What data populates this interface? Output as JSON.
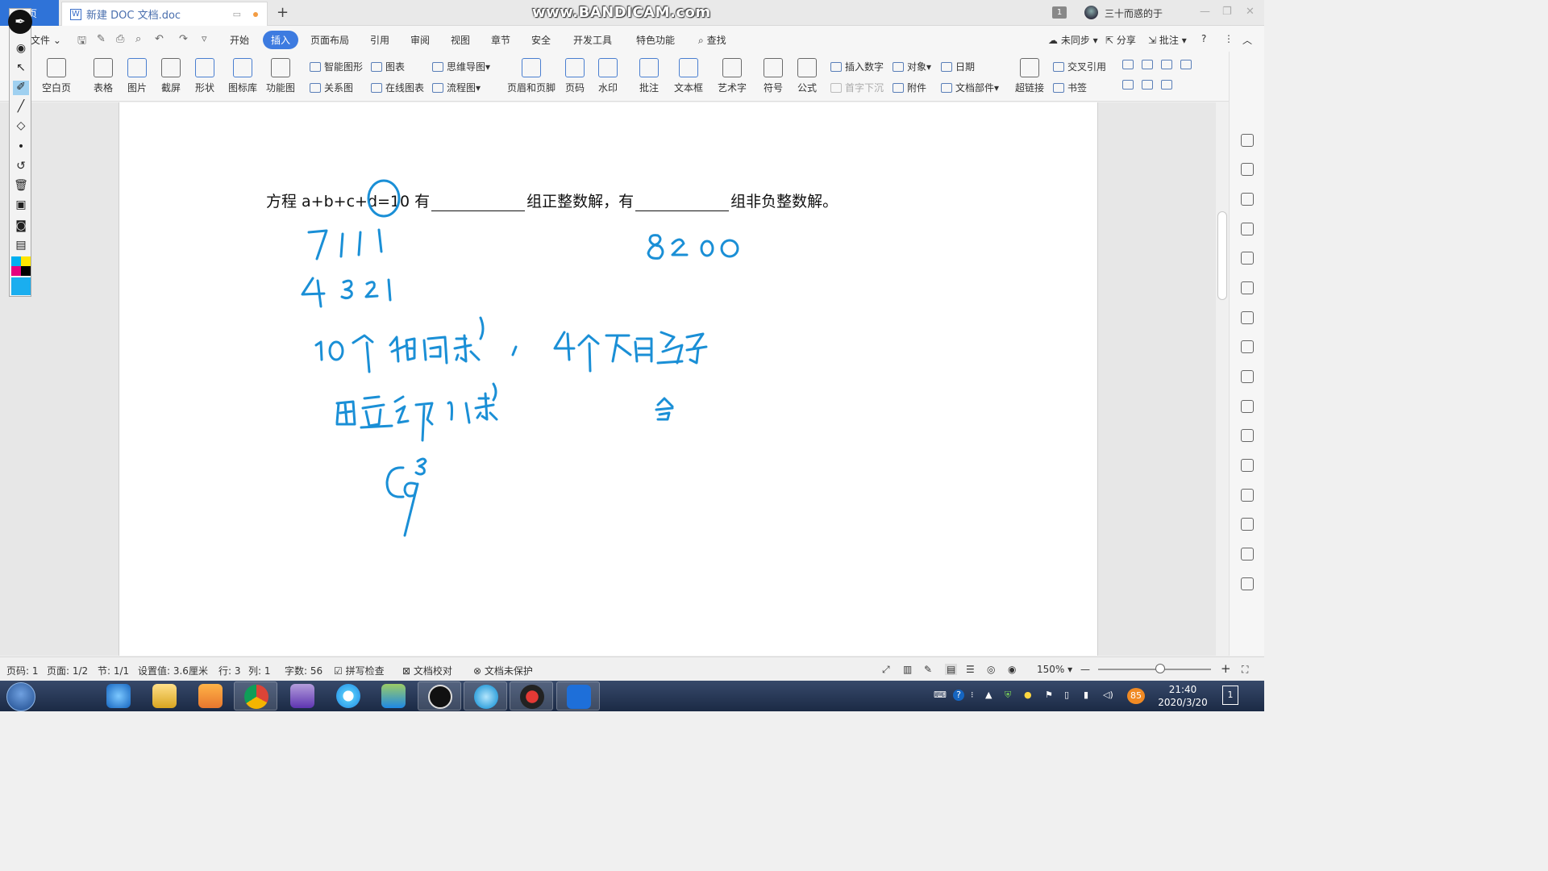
{
  "window": {
    "home_tab": "首页",
    "doc_tab": "新建 DOC 文档.doc",
    "new_tab": "+",
    "watermark": "www.BANDICAM.com",
    "badge": "1",
    "user": "三十而惑的于"
  },
  "menu": {
    "file": "文件",
    "tabs": [
      "开始",
      "插入",
      "页面布局",
      "引用",
      "审阅",
      "视图",
      "章节",
      "安全",
      "开发工具",
      "特色功能"
    ],
    "active_tab": "插入",
    "search": "查找",
    "right": [
      "未同步",
      "分享",
      "批注"
    ]
  },
  "ribbon": {
    "large": [
      "空白页",
      "表格",
      "图片",
      "截屏",
      "形状",
      "图标库",
      "功能图",
      "页眉和页脚",
      "页码",
      "水印",
      "批注",
      "文本框",
      "艺术字",
      "符号",
      "公式",
      "超链接"
    ],
    "small": [
      "智能图形",
      "图表",
      "思维导图",
      "关系图",
      "在线图表",
      "流程图",
      "插入数字",
      "对象",
      "日期",
      "首字下沉",
      "附件",
      "文档部件",
      "交叉引用",
      "书签"
    ]
  },
  "document": {
    "question_part1": "方程 a+b+c+d=10 有",
    "question_part2": "组正整数解，有",
    "question_part3": "组非负整数解。"
  },
  "statusbar": {
    "page": "页码: 1",
    "pages": "页面: 1/2",
    "section": "节: 1/1",
    "setting": "设置值: 3.6厘米",
    "row": "行: 3",
    "col": "列: 1",
    "words": "字数: 56",
    "spell": "拼写检查",
    "proof": "文档校对",
    "protect": "文档未保护",
    "zoom": "150%"
  },
  "taskbar": {
    "time": "21:40",
    "date": "2020/3/20",
    "battery": "85",
    "notif": "1"
  },
  "colors": {
    "accent": "#3d7be0",
    "ink": "#1a8fd6"
  }
}
